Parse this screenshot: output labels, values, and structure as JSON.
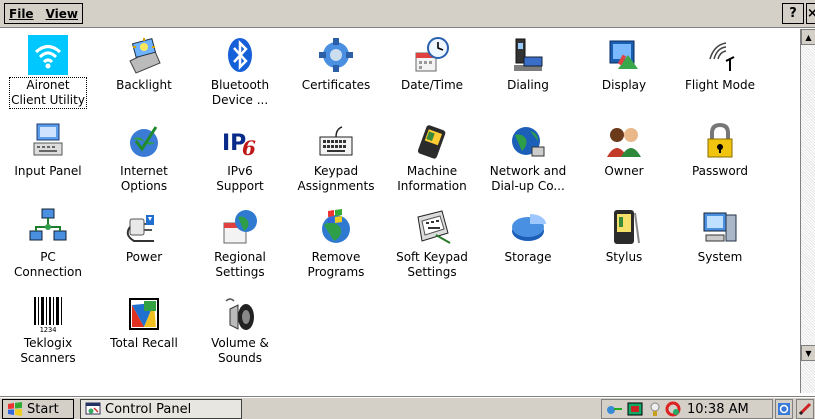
{
  "menubar": {
    "file_label": "File",
    "view_label": "View",
    "help_label": "?",
    "close_label": "×"
  },
  "items": [
    {
      "label": "Aironet\nClient Utility",
      "icon": "wifi-icon",
      "selected": true
    },
    {
      "label": "Backlight",
      "icon": "backlight-icon"
    },
    {
      "label": "Bluetooth\nDevice ...",
      "icon": "bluetooth-icon"
    },
    {
      "label": "Certificates",
      "icon": "certificates-icon"
    },
    {
      "label": "Date/Time",
      "icon": "clock-calendar-icon"
    },
    {
      "label": "Dialing",
      "icon": "phone-icon"
    },
    {
      "label": "Display",
      "icon": "display-icon"
    },
    {
      "label": "Flight Mode",
      "icon": "antenna-icon"
    },
    {
      "label": "Input Panel",
      "icon": "input-panel-icon"
    },
    {
      "label": "Internet\nOptions",
      "icon": "globe-check-icon"
    },
    {
      "label": "IPv6\nSupport",
      "icon": "ipv6-icon"
    },
    {
      "label": "Keypad\nAssignments",
      "icon": "keyboard-icon"
    },
    {
      "label": "Machine\nInformation",
      "icon": "handheld-device-icon"
    },
    {
      "label": "Network and\nDial-up Co...",
      "icon": "network-globe-icon"
    },
    {
      "label": "Owner",
      "icon": "users-icon"
    },
    {
      "label": "Password",
      "icon": "padlock-icon"
    },
    {
      "label": "PC\nConnection",
      "icon": "pc-network-icon"
    },
    {
      "label": "Power",
      "icon": "power-plug-icon"
    },
    {
      "label": "Regional\nSettings",
      "icon": "globe-calendar-icon"
    },
    {
      "label": "Remove\nPrograms",
      "icon": "windows-globe-icon"
    },
    {
      "label": "Soft Keypad\nSettings",
      "icon": "soft-keypad-icon"
    },
    {
      "label": "Storage",
      "icon": "pie-chart-icon"
    },
    {
      "label": "Stylus",
      "icon": "pda-stylus-icon"
    },
    {
      "label": "System",
      "icon": "computer-icon"
    },
    {
      "label": "Teklogix\nScanners",
      "icon": "barcode-icon"
    },
    {
      "label": "Total Recall",
      "icon": "total-recall-icon"
    },
    {
      "label": "Volume &\nSounds",
      "icon": "speaker-icon"
    }
  ],
  "taskbar": {
    "start_label": "Start",
    "task_label": "Control Panel",
    "clock": "10:38 AM"
  },
  "colors": {
    "chrome": "#d4d0c8",
    "wifi_tile": "#00c8ff",
    "selection_outline": "#000000"
  }
}
